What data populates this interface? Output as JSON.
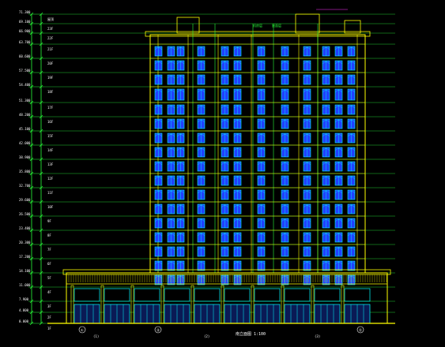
{
  "drawing": {
    "title_label": "南立面图 1:100",
    "background": "#000000",
    "colors": {
      "outline": "#ffff00",
      "window_frame": "#00ffff",
      "window_glass": "#2040ff",
      "dim": "#29ff3a",
      "text": "#ffffff",
      "magenta": "#ff33ff"
    }
  },
  "elevation_marks": [
    "71.300",
    "69.100",
    "66.900",
    "63.700",
    "60.600",
    "57.500",
    "54.400",
    "51.300",
    "48.200",
    "45.100",
    "42.000",
    "38.900",
    "35.800",
    "32.700",
    "29.600",
    "26.500",
    "23.400",
    "20.300",
    "17.200",
    "14.100",
    "11.000",
    "7.900",
    "4.800",
    "0.000"
  ],
  "floor_marks": [
    "屋顶",
    "23F",
    "22F",
    "21F",
    "20F",
    "19F",
    "18F",
    "17F",
    "16F",
    "15F",
    "14F",
    "13F",
    "12F",
    "11F",
    "10F",
    "9F",
    "8F",
    "7F",
    "6F",
    "5F",
    "4F",
    "3F",
    "2F",
    "1F"
  ],
  "axis_labels": [
    "①",
    "⑮",
    "㉛"
  ],
  "top_notes": [
    "机房层",
    "屋面层"
  ],
  "side_notes": [
    "(1)",
    "(2)",
    "(3)"
  ]
}
